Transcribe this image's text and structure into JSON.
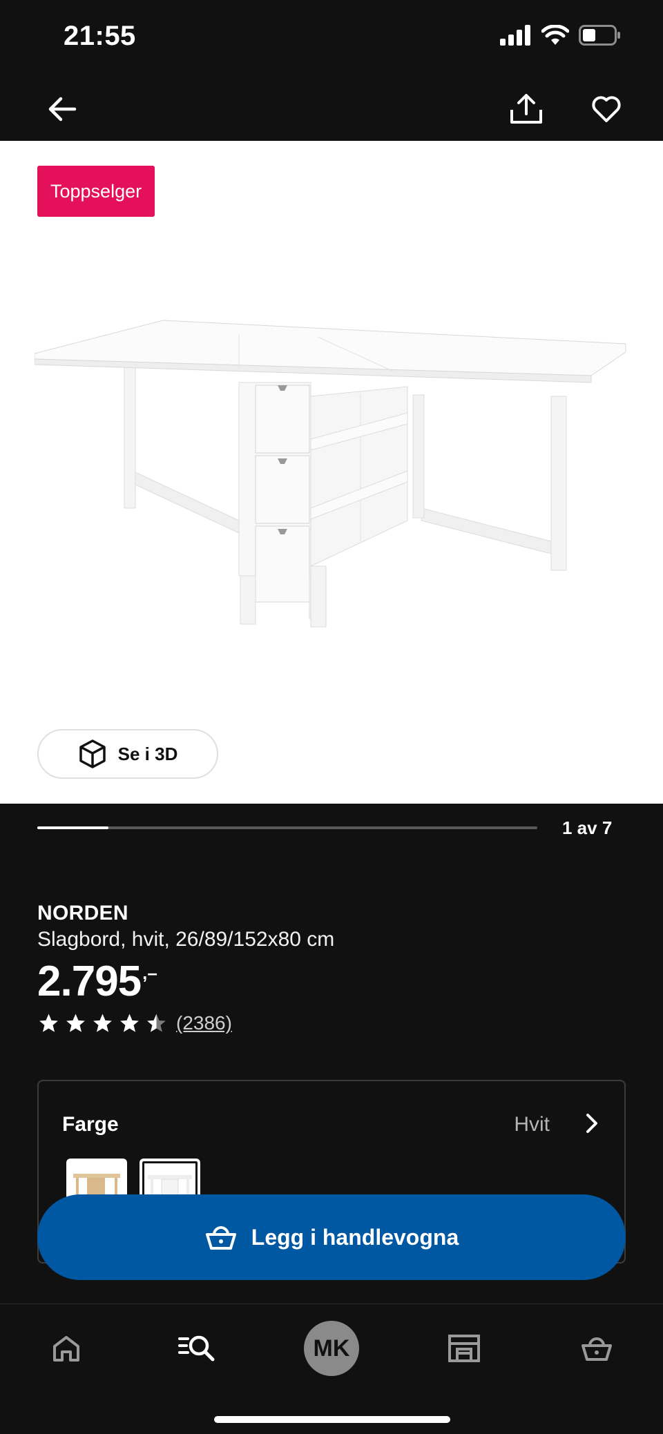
{
  "status_bar": {
    "time": "21:55",
    "icons": [
      "signal-icon",
      "wifi-icon",
      "battery-icon"
    ]
  },
  "top_nav": {
    "icons": [
      "back-arrow-icon",
      "share-icon",
      "heart-icon"
    ]
  },
  "image_area": {
    "badge": "Toppselger",
    "badge_color": "#e4105a",
    "view_3d_label": "Se i 3D",
    "view_3d_icon": "cube-icon"
  },
  "carousel": {
    "counter": "1 av 7",
    "current": 1,
    "total": 7
  },
  "product": {
    "name": "NORDEN",
    "description": "Slagbord, hvit, 26/89/152x80 cm",
    "price_main": "2.795",
    "price_suffix": ",–",
    "rating": 4.5,
    "rating_max": 5,
    "review_count": "(2386)"
  },
  "color_selector": {
    "label": "Farge",
    "value": "Hvit",
    "options": [
      "birch",
      "white"
    ],
    "selected": "white"
  },
  "cart_button": {
    "label": "Legg i handlevogna",
    "color": "#0058a3",
    "icon": "basket-icon"
  },
  "bottom_nav": {
    "tabs": [
      "home-icon",
      "search-icon",
      "profile",
      "store-icon",
      "basket-icon"
    ],
    "avatar_initials": "MK"
  }
}
